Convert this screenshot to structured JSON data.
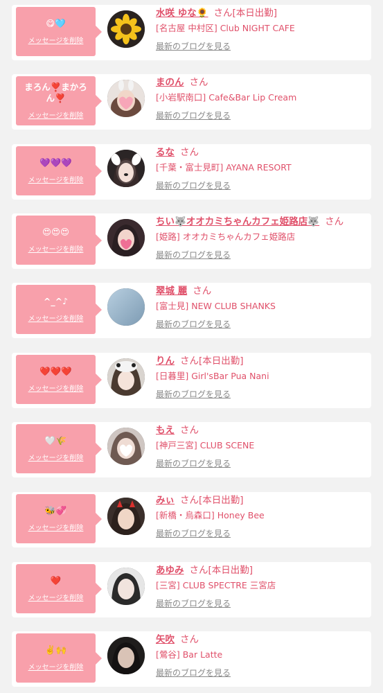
{
  "delete_label": "メッセージを削除",
  "honorific": "さん",
  "blog_link": "最新のブログを見る",
  "colors": {
    "accent": "#e0506a",
    "bubble": "#f8a0ab",
    "background": "#f2f2f2"
  },
  "items": [
    {
      "message": "😋🩵",
      "name": "水咲 ゆな🌻",
      "tag": "[本日出勤]",
      "shop": "[名古屋 中村区] Club NIGHT CAFE",
      "avatar": "sunflower-photo"
    },
    {
      "message": "まろん❣️まかろん❣️",
      "name": "まのん",
      "tag": "",
      "shop": "[小岩駅南口] Cafe&Bar Lip Cream",
      "avatar": "girl-heart-sticker-photo"
    },
    {
      "message": "💜💜💜",
      "name": "るな",
      "tag": "",
      "shop": "[千葉・富士見町] AYANA RESORT",
      "avatar": "girl-dog-filter-photo"
    },
    {
      "message": "😍😍😍",
      "name": "ちい🐺オオカミちゃんカフェ姫路店🐺",
      "tag": "",
      "shop": "[姫路] オオカミちゃんカフェ姫路店",
      "avatar": "girl-heart-sticker-photo"
    },
    {
      "message": "^_^♪",
      "name": "翠城 麗",
      "tag": "",
      "shop": "[富士見] NEW CLUB SHANKS",
      "avatar": "no-photo-placeholder"
    },
    {
      "message": "❤️❤️❤️",
      "name": "りん",
      "tag": "[本日出勤]",
      "shop": "[日暮里] Girl'sBar Pua Nani",
      "avatar": "girl-hood-photo"
    },
    {
      "message": "🤍🌾",
      "name": "もえ",
      "tag": "",
      "shop": "[神戸三宮] CLUB SCENE",
      "avatar": "girl-heart-sticker-photo"
    },
    {
      "message": "🐝💞",
      "name": "みぃ",
      "tag": "[本日出勤]",
      "shop": "[新橋・烏森口] Honey Bee",
      "avatar": "girl-devil-horns-photo"
    },
    {
      "message": "❤️",
      "name": "あゆみ",
      "tag": "[本日出勤]",
      "shop": "[三宮] CLUB SPECTRE 三宮店",
      "avatar": "girl-portrait-photo"
    },
    {
      "message": "✌️🙌",
      "name": "矢吹",
      "tag": "",
      "shop": "[鶯谷] Bar Latte",
      "avatar": "girl-portrait-photo"
    }
  ]
}
